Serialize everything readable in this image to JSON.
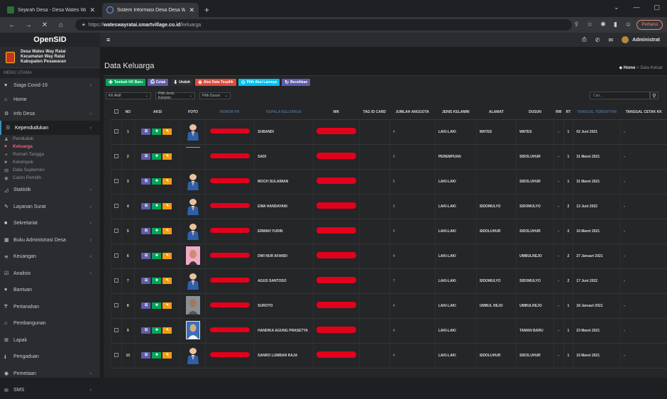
{
  "browser": {
    "tabs": [
      {
        "title": "Sejarah Desa - Desa Wates Way R"
      },
      {
        "title": "Sistem Informasi Desa Desa Wate"
      }
    ],
    "url_prefix": "https://",
    "url_domain": "wateswayratai.smartvillage.co.id",
    "url_path": "/keluarga",
    "update_label": "Perbarui"
  },
  "sidebar": {
    "brand": "OpenSID",
    "village_line1": "Desa Wates Way Ratai",
    "village_line2": "Kecamatan Way Ratai",
    "village_line3": "Kabupaten Pesawaran",
    "menu_header": "MENU UTAMA",
    "items": [
      {
        "label": "Siaga Covid-19",
        "icon": "heart-icon",
        "glyph": "♥",
        "chevron": true
      },
      {
        "label": "Home",
        "icon": "home-icon",
        "glyph": "⌂",
        "chevron": false
      },
      {
        "label": "Info Desa",
        "icon": "info-desa-icon",
        "glyph": "⚙",
        "chevron": true
      },
      {
        "label": "Kependudukan",
        "icon": "users-icon",
        "glyph": "☰",
        "chevron": true
      }
    ],
    "subitems": [
      {
        "label": "Penduduk",
        "glyph": "♟",
        "icon": "person-icon"
      },
      {
        "label": "Keluarga",
        "glyph": "♥",
        "icon": "family-icon"
      },
      {
        "label": "Rumah Tangga",
        "glyph": "⚭",
        "icon": "household-icon"
      },
      {
        "label": "Kelompok",
        "glyph": "♣",
        "icon": "group-icon"
      },
      {
        "label": "Data Suplemen",
        "glyph": "▤",
        "icon": "supplement-icon"
      },
      {
        "label": "Calon Pemilih",
        "glyph": "◉",
        "icon": "voter-icon"
      }
    ],
    "items2": [
      {
        "label": "Statistik",
        "glyph": "◿",
        "icon": "chart-icon",
        "chevron": true
      },
      {
        "label": "Layanan Surat",
        "glyph": "✎",
        "icon": "letter-icon",
        "chevron": true
      },
      {
        "label": "Sekretariat",
        "glyph": "■",
        "icon": "secretariat-icon",
        "chevron": true
      },
      {
        "label": "Buku Administrasi Desa",
        "glyph": "▦",
        "icon": "book-icon",
        "chevron": true
      },
      {
        "label": "Keuangan",
        "glyph": "≋",
        "icon": "finance-icon",
        "chevron": true
      },
      {
        "label": "Analisis",
        "glyph": "☑",
        "icon": "analysis-icon",
        "chevron": true
      },
      {
        "label": "Bantuan",
        "glyph": "♥",
        "icon": "aid-icon",
        "chevron": false
      },
      {
        "label": "Pertanahan",
        "glyph": "₸",
        "icon": "land-icon",
        "chevron": false
      },
      {
        "label": "Pembangunan",
        "glyph": "⌂",
        "icon": "building-icon",
        "chevron": false
      },
      {
        "label": "Lapak",
        "glyph": "⊞",
        "icon": "market-icon",
        "chevron": false
      },
      {
        "label": "Pengaduan",
        "glyph": "ℹ",
        "icon": "complaint-icon",
        "chevron": false
      },
      {
        "label": "Pemetaan",
        "glyph": "◉",
        "icon": "map-icon",
        "chevron": true
      },
      {
        "label": "SMS",
        "glyph": "✉",
        "icon": "sms-icon",
        "chevron": true
      }
    ]
  },
  "topnav": {
    "admin_label": "Administrat"
  },
  "page": {
    "title": "Data Keluarga",
    "breadcrumb_home": "Home",
    "breadcrumb_current": "Data Keluar"
  },
  "toolbar": {
    "buttons": [
      {
        "label": "Tambah KK Baru",
        "glyph": "✚",
        "color": "#00a65a",
        "icon": "plus-icon"
      },
      {
        "label": "Cetak",
        "glyph": "⎙",
        "color": "#605ca8",
        "icon": "print-icon"
      },
      {
        "label": "Unduh",
        "glyph": "⬇",
        "color": "#2c2e31",
        "icon": "download-icon"
      },
      {
        "label": "Aksi Data Terpilih",
        "glyph": "⊗",
        "color": "#dd4b39",
        "icon": "action-icon"
      },
      {
        "label": "Pilih Aksi Lainnya",
        "glyph": "⊙",
        "color": "#00c0ef",
        "icon": "more-icon"
      },
      {
        "label": "Bersihkan",
        "glyph": "↻",
        "color": "#605ca8",
        "icon": "refresh-icon"
      }
    ]
  },
  "filters": {
    "status": "KK Aktif",
    "gender": "Pilih Jenis Kelamin",
    "dusun": "Pilih Dusun",
    "search_placeholder": "Cari..."
  },
  "table": {
    "headers": [
      "NO",
      "AKSI",
      "FOTO",
      "NOMOR KK",
      "KEPALA KELUARGA",
      "NIK",
      "TAG ID CARD",
      "JUMLAH ANGGOTA",
      "JENIS KELAMIN",
      "ALAMAT",
      "DUSUN",
      "RW",
      "RT",
      "TANGGAL TERDAFTAR",
      "TANGGAL CETAK KK"
    ],
    "rows": [
      {
        "no": "1",
        "kepala": "SUBANDI",
        "jumlah": "4",
        "jk": "LAKI-LAKI",
        "alamat": "WATES",
        "dusun": "WATES",
        "rw": "-",
        "rt": "1",
        "tgl": "02 Juni 2021",
        "cetak": "-",
        "foto": "avatar"
      },
      {
        "no": "2",
        "kepala": "SADI",
        "jumlah": "3",
        "jk": "PEREMPUAN",
        "alamat": "",
        "dusun": "SIDOLUHUR",
        "rw": "-",
        "rt": "1",
        "tgl": "31 Maret 2021",
        "cetak": "-",
        "foto": "blank"
      },
      {
        "no": "3",
        "kepala": "MOCH SULAIMAN",
        "jumlah": "5",
        "jk": "LAKI-LAKI",
        "alamat": "",
        "dusun": "SIDOLUHUR",
        "rw": "-",
        "rt": "1",
        "tgl": "31 Maret 2021",
        "cetak": "-",
        "foto": "avatar"
      },
      {
        "no": "4",
        "kepala": "EWA HANDAYANI",
        "jumlah": "3",
        "jk": "LAKI-LAKI",
        "alamat": "SIDOMULYO",
        "dusun": "SIDOMULYO",
        "rw": "-",
        "rt": "2",
        "tgl": "13 Juni 2022",
        "cetak": "-",
        "foto": "avatar"
      },
      {
        "no": "5",
        "kepala": "ERWAH YUDIN",
        "jumlah": "3",
        "jk": "LAKI-LAKI",
        "alamat": "SIDOLUHUR",
        "dusun": "SIDOLUHUR",
        "rw": "-",
        "rt": "2",
        "tgl": "16 Maret 2021",
        "cetak": "-",
        "foto": "avatar"
      },
      {
        "no": "6",
        "kepala": "DWI NUR AFANDI",
        "jumlah": "4",
        "jk": "LAKI-LAKI",
        "alamat": "",
        "dusun": "UMBULREJO",
        "rw": "-",
        "rt": "2",
        "tgl": "27 Januari 2021",
        "cetak": "-",
        "foto": "photo-pink"
      },
      {
        "no": "7",
        "kepala": "AGUS SANTOSO",
        "jumlah": "7",
        "jk": "LAKI-LAKI",
        "alamat": "SIDOMULYO",
        "dusun": "SIDOMULYO",
        "rw": "-",
        "rt": "2",
        "tgl": "17 Juni 2022",
        "cetak": "-",
        "foto": "avatar"
      },
      {
        "no": "8",
        "kepala": "SUROTO",
        "jumlah": "4",
        "jk": "LAKI-LAKI",
        "alamat": "UMBUL REJO",
        "dusun": "UMBULREJO",
        "rw": "-",
        "rt": "1",
        "tgl": "18 Januari 2021",
        "cetak": "-",
        "foto": "photo-grey"
      },
      {
        "no": "9",
        "kepala": "HANDIKA AGUNG PRASETYA",
        "jumlah": "4",
        "jk": "LAKI-LAKI",
        "alamat": "",
        "dusun": "TAMAN BARU",
        "rw": "-",
        "rt": "1",
        "tgl": "23 Maret 2021",
        "cetak": "-",
        "foto": "photo-blue"
      },
      {
        "no": "10",
        "kepala": "SANRO LUMBAN RAJA",
        "jumlah": "4",
        "jk": "LAKI-LAKI",
        "alamat": "SIDOLUHUR",
        "dusun": "SIDOLUHUR",
        "rw": "-",
        "rt": "1",
        "tgl": "15 Maret 2021",
        "cetak": "-",
        "foto": "avatar"
      }
    ]
  }
}
